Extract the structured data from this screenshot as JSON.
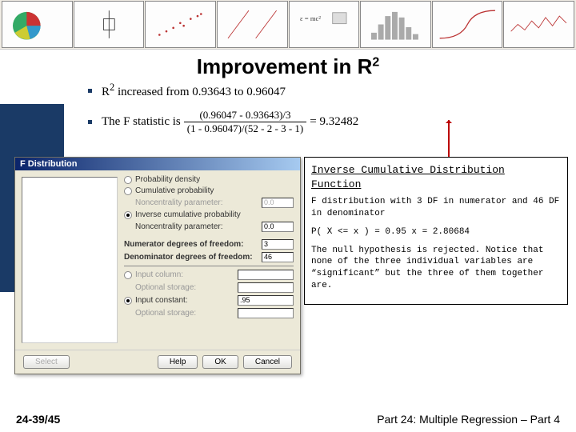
{
  "slide": {
    "title_a": "Improvement in R",
    "title_sup": "2",
    "math1_a": "R",
    "math1_sup": "2",
    "math1_b": " increased from 0.93643 to 0.96047",
    "math2_a": "The F statistic is ",
    "frac_num": "(0.96047 - 0.93643)/3",
    "frac_den": "(1 - 0.96047)/(52 - 2 - 3 - 1)",
    "math2_b": " = 9.32482"
  },
  "dialog": {
    "title": "F Distribution",
    "r1": "Probability density",
    "r2": "Cumulative probability",
    "ncp": "Noncentrality parameter:",
    "ncp_v": "0.0",
    "r3": "Inverse cumulative probability",
    "num_df": "Numerator degrees of freedom:",
    "num_df_v": "3",
    "den_df": "Denominator degrees of freedom:",
    "den_df_v": "46",
    "in_col": "Input column:",
    "store": "Optional storage:",
    "in_const": "Input constant:",
    "in_const_v": ".95",
    "select": "Select",
    "help": "Help",
    "ok": "OK",
    "cancel": "Cancel"
  },
  "output": {
    "hdg": "Inverse Cumulative Distribution Function",
    "p1": "F distribution with 3 DF in numerator and 46 DF in denominator",
    "p2": "P( X <= x ) = 0.95   x = 2.80684",
    "p3": "The null hypothesis is rejected. Notice that none of the three individual variables are “significant” but the three of them together are."
  },
  "footer": {
    "left": "24-39/45",
    "right": "Part 24: Multiple Regression – Part 4"
  }
}
